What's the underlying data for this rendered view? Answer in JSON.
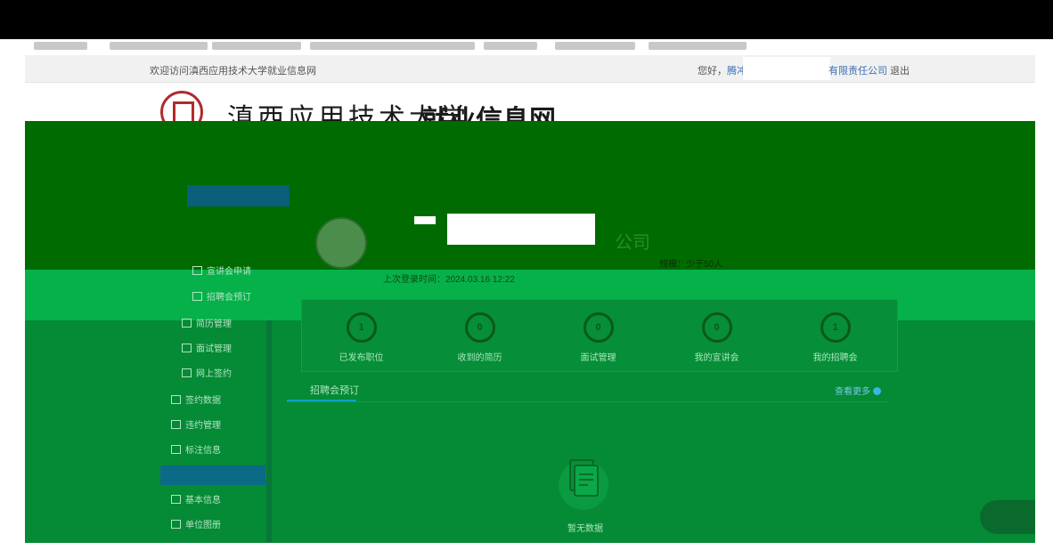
{
  "header": {
    "welcome": "欢迎访问滇西应用技术大学就业信息网",
    "hello_prefix": "您好，",
    "user_link": "腾冲",
    "company_suffix": "有限责任公司",
    "logout": "退出"
  },
  "logo": {
    "school_name": "滇西应用技术大学",
    "portal_name": "就业信息网"
  },
  "profile": {
    "company_tail": "公司",
    "scale_label": "规模：少于50人",
    "last_login": "上次登录时间：2024.03.16 12:22"
  },
  "sidenav": {
    "items": [
      {
        "label": "宣讲会申请"
      },
      {
        "label": "招聘会预订"
      },
      {
        "label": "简历管理"
      },
      {
        "label": "面试管理"
      },
      {
        "label": "网上签约"
      },
      {
        "label": "签约数据"
      },
      {
        "label": "违约管理"
      },
      {
        "label": "标注信息"
      },
      {
        "label": "基本信息"
      },
      {
        "label": "单位图册"
      }
    ]
  },
  "stats": [
    {
      "value": "1",
      "label": "已发布职位"
    },
    {
      "value": "0",
      "label": "收到的简历"
    },
    {
      "value": "0",
      "label": "面试管理"
    },
    {
      "value": "0",
      "label": "我的宣讲会"
    },
    {
      "value": "1",
      "label": "我的招聘会"
    }
  ],
  "fairs": {
    "tab_label": "招聘会预订",
    "view_more": "查看更多",
    "empty_text": "暂无数据"
  },
  "colors": {
    "dark_green": "#006b00",
    "bright_green": "#06b14a",
    "mid_green": "#058a35",
    "accent_blue": "#3a6fb6"
  }
}
